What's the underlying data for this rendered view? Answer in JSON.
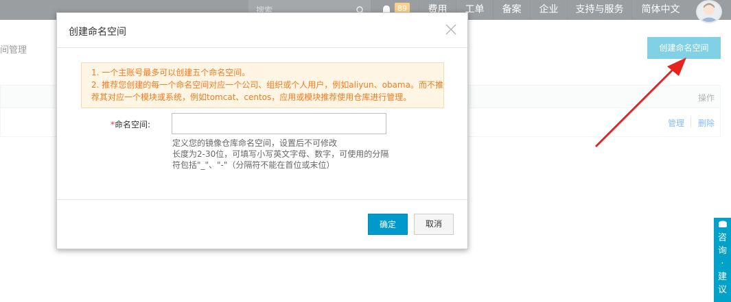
{
  "topbar": {
    "search_placeholder": "搜索",
    "notification_count": "89",
    "nav": [
      "费用",
      "工单",
      "备案",
      "企业",
      "支持与服务",
      "简体中文"
    ]
  },
  "page": {
    "title": "间管理",
    "create_button": "创建命名空间",
    "table_header_operation": "操作",
    "row_manage": "管理",
    "row_delete": "删除"
  },
  "dialog": {
    "title": "创建命名空间",
    "notice_lines": [
      "1. 一个主账号最多可以创建五个命名空间。",
      "2. 推荐您创建的每一个命名空间对应一个公司、组织或个人用户，例如aliyun、obama。而不推",
      "荐其对应一个模块或系统，例如tomcat、centos，应用或模块推荐使用仓库进行管理。"
    ],
    "field_required_mark": "*",
    "field_label": "命名空间:",
    "field_value": "",
    "help_lines": [
      "定义您的镜像仓库命名空间，设置后不可修改",
      "长度为2-30位，可填写小写英文字母、数字，可使用的分隔",
      "符包括\"_\"、\"-\"（分隔符不能在首位或末位）"
    ],
    "confirm_label": "确定",
    "cancel_label": "取消"
  },
  "side_consult": {
    "label": "咨询·建议"
  },
  "colors": {
    "topbar": "#373d41",
    "primary": "#00a2ca",
    "notice_text": "#f57a1d",
    "notice_bg": "#fff5e5",
    "arrow": "#e8231f"
  },
  "icons": [
    "search-icon",
    "bell-icon",
    "close-icon",
    "avatar",
    "chat-icon",
    "annotation-arrow"
  ]
}
